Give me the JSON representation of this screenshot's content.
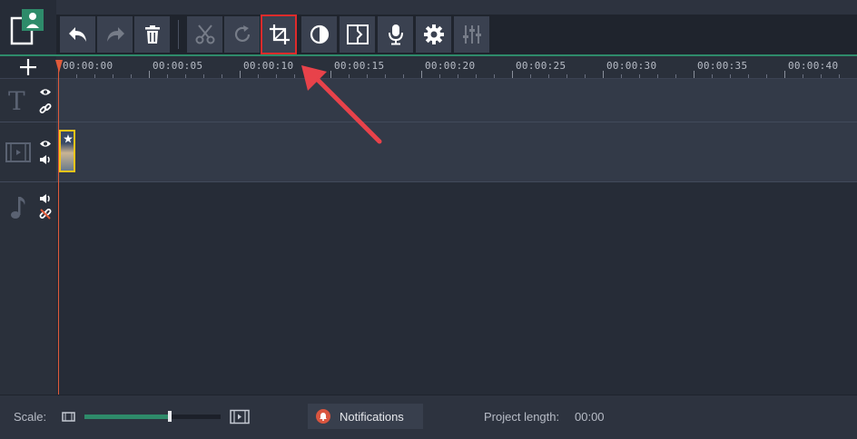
{
  "toolbar": {
    "buttons": [
      {
        "name": "undo",
        "icon": "undo-icon"
      },
      {
        "name": "redo",
        "icon": "redo-icon"
      },
      {
        "name": "delete",
        "icon": "trash-icon"
      },
      {
        "name": "cut",
        "icon": "scissors-icon"
      },
      {
        "name": "rotate",
        "icon": "rotate-icon"
      },
      {
        "name": "crop",
        "icon": "crop-icon"
      },
      {
        "name": "color-adjust",
        "icon": "contrast-icon"
      },
      {
        "name": "transition",
        "icon": "transition-icon"
      },
      {
        "name": "record-voice",
        "icon": "microphone-icon"
      },
      {
        "name": "clip-properties",
        "icon": "gear-icon"
      },
      {
        "name": "equalizer",
        "icon": "equalizer-icon"
      }
    ],
    "highlighted": "crop"
  },
  "ruler": {
    "labels": [
      "00:00:00",
      "00:00:05",
      "00:00:10",
      "00:00:15",
      "00:00:20",
      "00:00:25",
      "00:00:30",
      "00:00:35",
      "00:00:40"
    ]
  },
  "tracks": {
    "text_track_icon": "T"
  },
  "bottom": {
    "scale_label": "Scale:",
    "notifications_label": "Notifications",
    "project_length_label": "Project length:",
    "project_length_value": "00:00"
  },
  "colors": {
    "accent": "#2e8b6a",
    "highlight_box": "#e02b2b",
    "arrow": "#e8424a",
    "playhead": "#e05a3a",
    "clip_border": "#f0c419"
  }
}
